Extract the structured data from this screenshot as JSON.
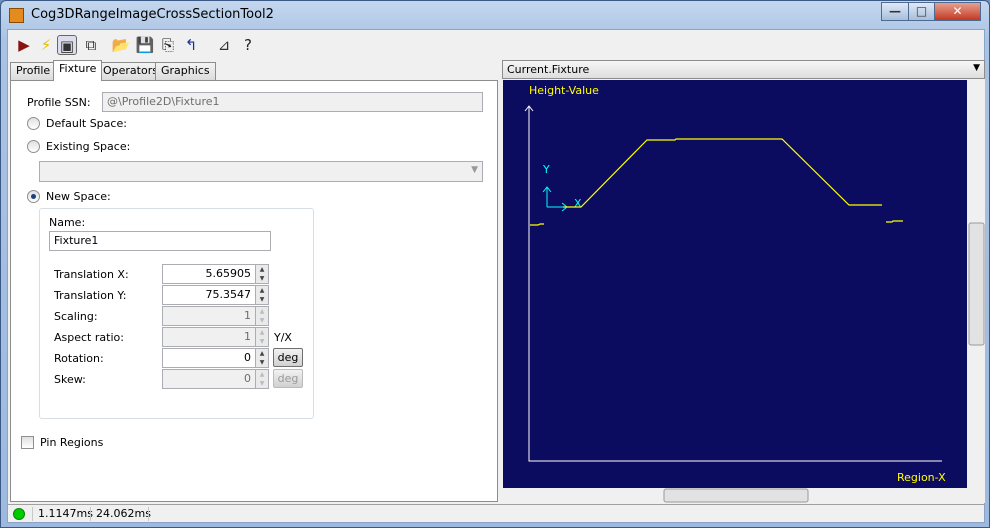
{
  "window": {
    "title": "Cog3DRangeImageCrossSectionTool2",
    "minimize": "—",
    "maximize": "□",
    "close": "✕"
  },
  "toolbar": [
    {
      "name": "run-icon",
      "glyph": "▶"
    },
    {
      "name": "lightning-icon",
      "glyph": "⚡"
    },
    {
      "name": "show-panel-icon",
      "glyph": "▣"
    },
    {
      "name": "floating-panel-icon",
      "glyph": "⧉"
    },
    {
      "name": "open-icon",
      "glyph": "📂"
    },
    {
      "name": "save-icon",
      "glyph": "💾"
    },
    {
      "name": "save-as-icon",
      "glyph": "⎘"
    },
    {
      "name": "reset-icon",
      "glyph": "↰"
    },
    {
      "name": "selector-icon",
      "glyph": "⊿"
    },
    {
      "name": "help-icon",
      "glyph": "?"
    }
  ],
  "tabs": [
    "Profile",
    "Fixture",
    "Operators",
    "Graphics"
  ],
  "active_tab": "Fixture",
  "fixture": {
    "profile_ssn_label": "Profile SSN:",
    "profile_ssn_value": "@\\Profile2D\\Fixture1",
    "default_space": "Default Space:",
    "existing_space": "Existing Space:",
    "existing_space_value": "",
    "new_space": "New Space:",
    "selected_space": "New Space",
    "name_label": "Name:",
    "name_value": "Fixture1",
    "translation_x_label": "Translation X:",
    "translation_x": "5.65905",
    "translation_y_label": "Translation Y:",
    "translation_y": "75.3547",
    "scaling_label": "Scaling:",
    "scaling": "1",
    "aspect_label": "Aspect ratio:",
    "aspect": "1",
    "aspect_unit": "Y/X",
    "rotation_label": "Rotation:",
    "rotation": "0",
    "rotation_unit": "deg",
    "skew_label": "Skew:",
    "skew": "0",
    "skew_unit": "deg",
    "pin_regions": "Pin Regions",
    "pin_regions_checked": false
  },
  "display": {
    "selector": "Current.Fixture",
    "y_axis_label": "Height-Value",
    "x_axis_label": "Region-X",
    "fixture_x": "X",
    "fixture_y": "Y",
    "background": "#0b0b60",
    "profile_color": "#ffff00",
    "axis_color": "#ffffff",
    "fixture_color": "#00ffff"
  },
  "status": {
    "indicator_color": "#00cc00",
    "time1": "1.1147ms",
    "time2": "24.062ms"
  }
}
